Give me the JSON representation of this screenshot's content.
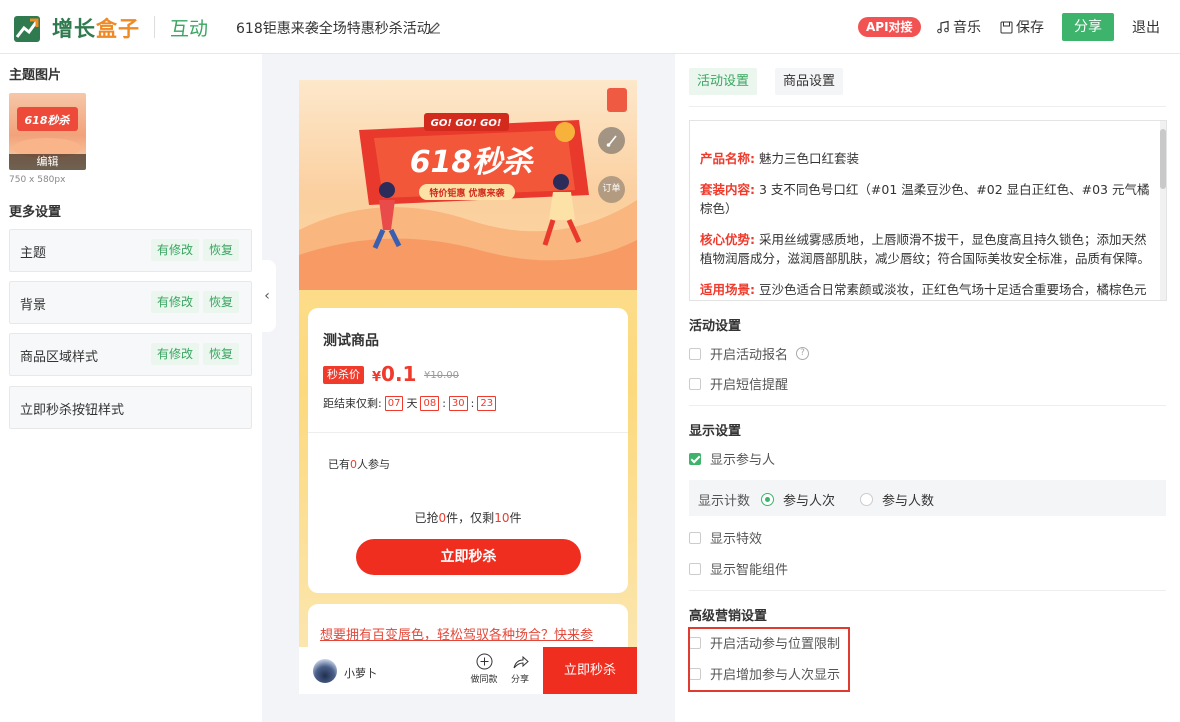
{
  "header": {
    "logo_text_a": "增长",
    "logo_text_b": "盒子",
    "module": "互动",
    "activity_title": "618钜惠来袭全场特惠秒杀活动",
    "api_badge": "API对接",
    "music_label": "音乐",
    "save_label": "保存",
    "share_label": "分享",
    "exit_label": "退出"
  },
  "left": {
    "theme_image_title": "主题图片",
    "thumb_edit": "编辑",
    "thumb_size": "750 x 580px",
    "more_settings_title": "更多设置",
    "items": [
      {
        "label": "主题",
        "modified": "有修改",
        "restore": "恢复"
      },
      {
        "label": "背景",
        "modified": "有修改",
        "restore": "恢复"
      },
      {
        "label": "商品区域样式",
        "modified": "有修改",
        "restore": "恢复"
      },
      {
        "label": "立即秒杀按钮样式"
      }
    ]
  },
  "preview": {
    "banner": {
      "go": "GO! GO! GO!",
      "title": "618秒杀",
      "subtitle": "特价钜惠 优惠来袭",
      "order_label": "订单"
    },
    "product_name": "测试商品",
    "price_tag": "秒杀价",
    "currency": "¥",
    "price": "0.1",
    "original_price": "¥10.00",
    "countdown_label": "距结束仅剩:",
    "days": "07",
    "day_unit": "天",
    "hours": "08",
    "minutes": "30",
    "seconds": "23",
    "join_prefix": "已有",
    "join_count": "0",
    "join_suffix": "人参与",
    "sold_prefix": "已抢",
    "sold_count": "0",
    "sold_mid": "件，仅剩",
    "remain_count": "10",
    "sold_suffix": "件",
    "seckill_button": "立即秒杀",
    "promo_text": "想要拥有百变唇色，轻松驾驭各种场合？快来参",
    "shop_name": "小萝卜",
    "same_label": "做同款",
    "share_label": "分享",
    "bottom_button": "立即秒杀"
  },
  "right": {
    "tabs": [
      "活动设置",
      "商品设置"
    ],
    "description": [
      {
        "key": "产品名称:",
        "text": "魅力三色口红套装"
      },
      {
        "key": "套装内容:",
        "text": "3 支不同色号口红（#01 温柔豆沙色、#02 显白正红色、#03 元气橘棕色）"
      },
      {
        "key": "核心优势:",
        "text": "采用丝绒雾感质地，上唇顺滑不拔干，显色度高且持久锁色；添加天然植物润唇成分，滋润唇部肌肤，减少唇纹；符合国际美妆安全标准，品质有保障。"
      },
      {
        "key": "适用场景:",
        "text": "豆沙色适合日常素颜或淡妆，正红色气场十足适合重要场合，橘棕色元"
      }
    ],
    "activity_settings_title": "活动设置",
    "enable_signup": "开启活动报名",
    "enable_sms": "开启短信提醒",
    "display_settings_title": "显示设置",
    "show_participants": "显示参与人",
    "display_count_label": "显示计数",
    "count_option_visits": "参与人次",
    "count_option_people": "参与人数",
    "show_effects": "显示特效",
    "show_smart": "显示智能组件",
    "advanced_title": "高级营销设置",
    "enable_location_limit": "开启活动参与位置限制",
    "enable_extra_visits": "开启增加参与人次显示"
  },
  "colors": {
    "brand_green": "#3db36b",
    "accent_red": "#ef2e20",
    "highlight_red": "#e03b31"
  }
}
